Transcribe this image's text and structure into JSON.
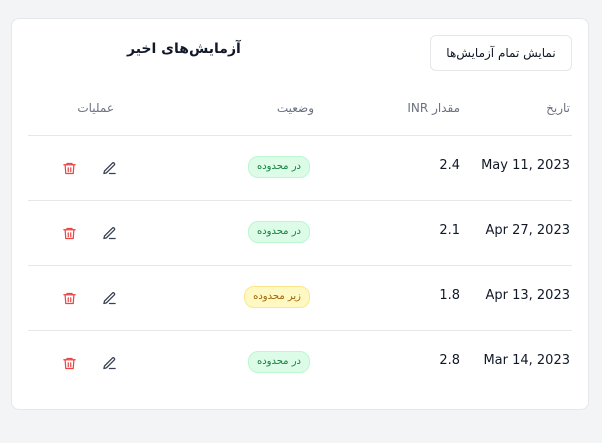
{
  "card": {
    "title": "آزمایش‌های اخیر",
    "view_all_label": "نمایش تمام آزمایش‌ها"
  },
  "table": {
    "headers": {
      "date": "تاریخ",
      "inr": "مقدار INR",
      "status": "وضعیت",
      "actions": "عملیات"
    },
    "rows": [
      {
        "date": "May 11, 2023",
        "inr": "2.4",
        "status": "در محدوده",
        "status_type": "in-range"
      },
      {
        "date": "Apr 27, 2023",
        "inr": "2.1",
        "status": "در محدوده",
        "status_type": "in-range"
      },
      {
        "date": "Apr 13, 2023",
        "inr": "1.8",
        "status": "زیر محدوده",
        "status_type": "below"
      },
      {
        "date": "Mar 14, 2023",
        "inr": "2.8",
        "status": "در محدوده",
        "status_type": "in-range"
      }
    ]
  },
  "icons": {
    "edit": "edit-icon",
    "delete": "trash-icon"
  },
  "colors": {
    "in_range_bg": "#dcfce7",
    "in_range_text": "#15803d",
    "below_bg": "#fef9c3",
    "below_text": "#a16207",
    "delete_icon": "#ef4444",
    "edit_icon": "#374151"
  }
}
